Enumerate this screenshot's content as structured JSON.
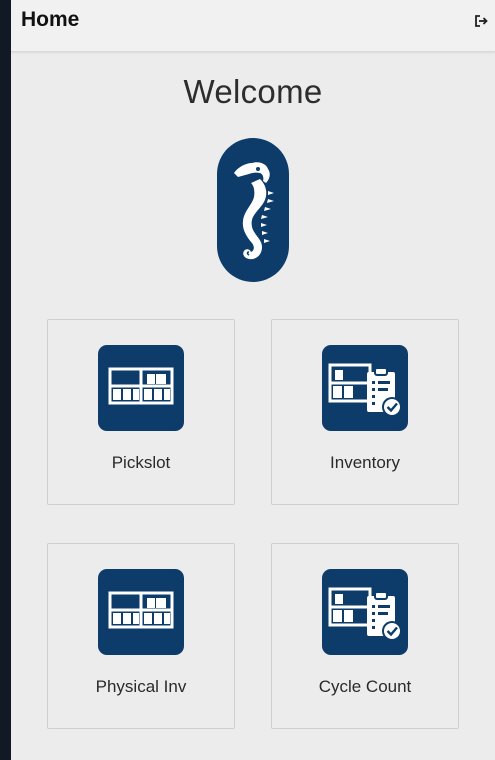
{
  "appbar": {
    "title": "Home",
    "logout_icon": "logout-icon"
  },
  "main": {
    "welcome": "Welcome",
    "logo_icon": "seahorse-logo-icon"
  },
  "tiles": [
    {
      "label": "Pickslot",
      "icon": "warehouse-shelf-icon"
    },
    {
      "label": "Inventory",
      "icon": "inventory-checklist-icon"
    },
    {
      "label": "Physical Inv",
      "icon": "warehouse-shelf-icon"
    },
    {
      "label": "Cycle Count",
      "icon": "inventory-checklist-icon"
    }
  ],
  "colors": {
    "brand": "#0d3c6b",
    "background": "#ececec",
    "frame": "#111a24"
  }
}
